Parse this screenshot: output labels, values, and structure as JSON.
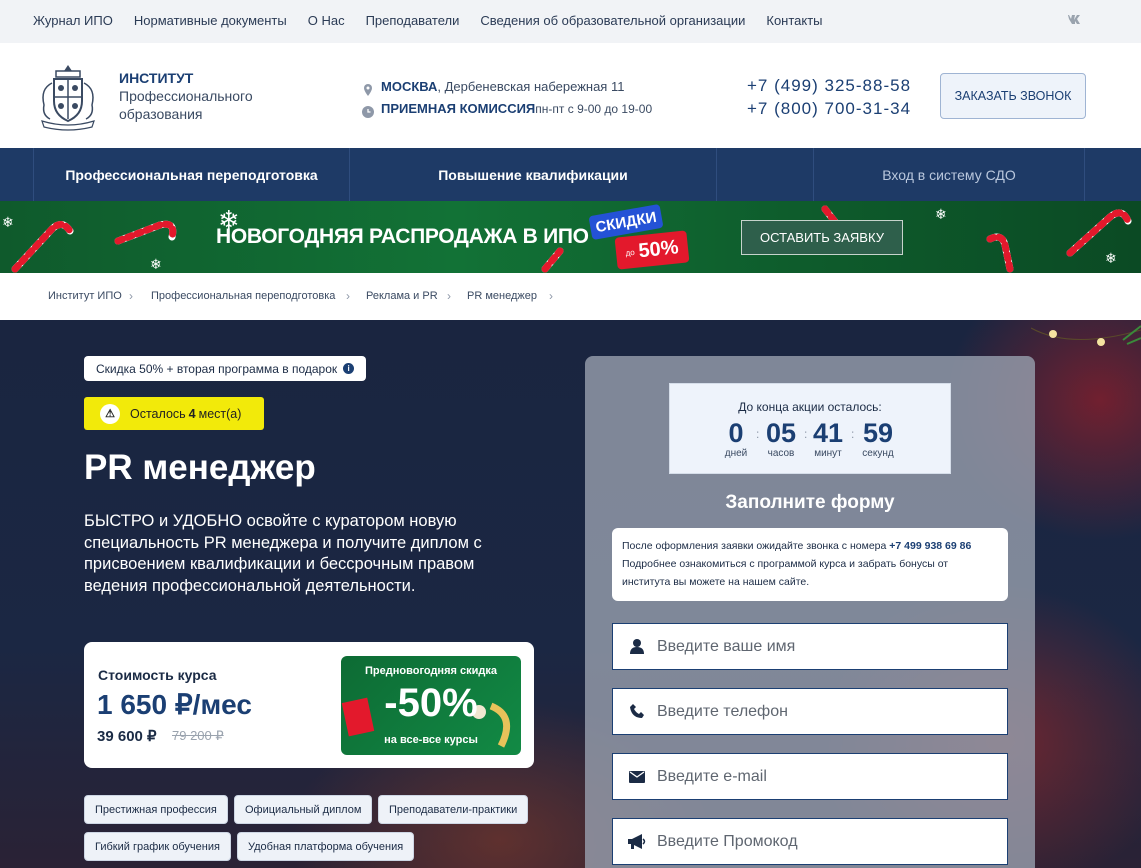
{
  "topbar": {
    "links": [
      "Журнал ИПО",
      "Нормативные документы",
      "О Нас",
      "Преподаватели",
      "Сведения об образовательной организации",
      "Контакты"
    ],
    "social": "vk"
  },
  "header": {
    "brand_line1": "ИНСТИТУТ",
    "brand_line2": "Профессионального",
    "brand_line3": "образования",
    "city": "МОСКВА",
    "address": ", Дербеневская набережная 11",
    "admission_label": "ПРИЕМНАЯ КОМИССИЯ",
    "admission_hours": " пн-пт с 9-00 до 19-00",
    "phone1": "+7 (499) 325-88-58",
    "phone2": "+7 (800) 700-31-34",
    "callback_button": "ЗАКАЗАТЬ ЗВОНОК"
  },
  "nav": {
    "items": [
      "Профессиональная переподготовка",
      "Повышение квалификации",
      "Вход в систему СДО"
    ]
  },
  "banner": {
    "title": "НОВОГОДНЯЯ РАСПРОДАЖА В ИПО",
    "badge_top": "СКИДКИ",
    "badge_prefix": "до",
    "badge_value": "50%",
    "button": "ОСТАВИТЬ ЗАЯВКУ"
  },
  "breadcrumb": [
    "Институт ИПО",
    "Профессиональная переподготовка",
    "Реклама и PR",
    "PR менеджер"
  ],
  "hero": {
    "offer_pill": "Скидка 50% + вторая программа в подарок",
    "seats_prefix": "Осталось ",
    "seats_count": "4",
    "seats_suffix": " мест(а)",
    "title": "PR менеджер",
    "lead": "БЫСТРО и УДОБНО освойте с куратором новую специальность PR менеджера и получите диплом с присвоением квалификации и бессрочным правом ведения профессиональной деятельности.",
    "price_label": "Стоимость курса",
    "price_monthly": "1 650 ₽/мес",
    "price_total": "39 600 ₽",
    "price_old": "79 200 ₽",
    "promo_top": "Предновогодняя скидка",
    "promo_value": "-50%",
    "promo_bottom": "на все-все курсы",
    "tags": [
      "Престижная профессия",
      "Официальный диплом",
      "Преподаватели-практики",
      "Гибкий график обучения",
      "Удобная платформа обучения"
    ]
  },
  "form": {
    "timer_title": "До конца акции осталось:",
    "days": "0",
    "days_label": "дней",
    "hours": "05",
    "hours_label": "часов",
    "minutes": "41",
    "minutes_label": "минут",
    "seconds": "59",
    "seconds_label": "секунд",
    "title": "Заполните форму",
    "note_prefix": "После оформления заявки ожидайте звонка с номера ",
    "note_phone": "+7 499 938 69 86",
    "note_rest": "Подробнее ознакомиться с программой курса и забрать бонусы от института вы можете на нашем сайте.",
    "name_placeholder": "Введите ваше имя",
    "phone_placeholder": "Введите телефон",
    "email_placeholder": "Введите e-mail",
    "promo_placeholder": "Введите Промокод"
  },
  "colors": {
    "navy": "#1e3a66",
    "brand": "#1b3f73",
    "banner_green": "#127236",
    "seats_yellow": "#f2ea0a",
    "badge_red": "#e3192c",
    "badge_blue": "#2452d6"
  }
}
